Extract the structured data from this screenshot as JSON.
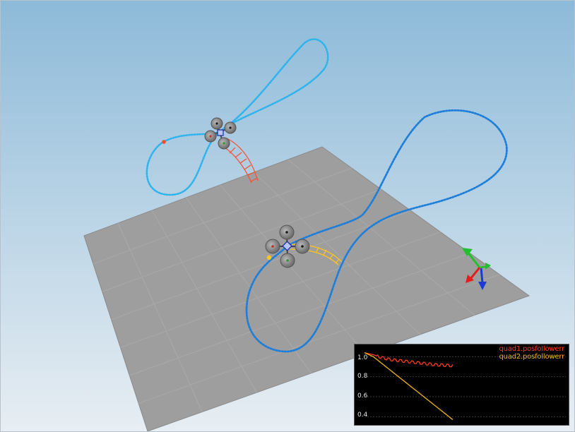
{
  "colors": {
    "sky_top": "#8dbad9",
    "sky_bottom": "#e8eef3",
    "floor": "#9e9e9e",
    "trajectory_near": "#1e7ed8",
    "trajectory_far": "#2fb3ec",
    "quad1_trail": "#ff4a2a",
    "quad2_trail": "#ffc51c",
    "axis_x": "#e0201c",
    "axis_y": "#22c030",
    "axis_z": "#1a3ad8"
  },
  "scene": {
    "objects": [
      "quad1",
      "quad2",
      "trajectory-quad1",
      "trajectory-quad2",
      "floor-grid",
      "world-axes"
    ]
  },
  "chart_data": {
    "type": "line",
    "x": [
      0,
      1,
      2,
      3,
      4,
      5,
      6,
      7,
      8,
      9,
      10
    ],
    "series": [
      {
        "name": "quad1.posfollowerr",
        "color": "#ff3a1e",
        "values": [
          1.04,
          1.02,
          0.99,
          0.97,
          0.96,
          0.95,
          0.94,
          0.93,
          0.92,
          0.915,
          0.91
        ]
      },
      {
        "name": "quad2.posfollowerr",
        "color": "#f0b21c",
        "values": [
          1.04,
          1.0,
          0.93,
          0.86,
          0.79,
          0.72,
          0.65,
          0.58,
          0.51,
          0.44,
          0.37
        ]
      }
    ],
    "y_ticks": [
      "1.0",
      "0.8",
      "0.6",
      "0.4"
    ],
    "y_tick_values": [
      1.0,
      0.8,
      0.6,
      0.4
    ],
    "ylim": [
      0.36,
      1.08
    ],
    "grid": true,
    "legend": "top-right"
  }
}
